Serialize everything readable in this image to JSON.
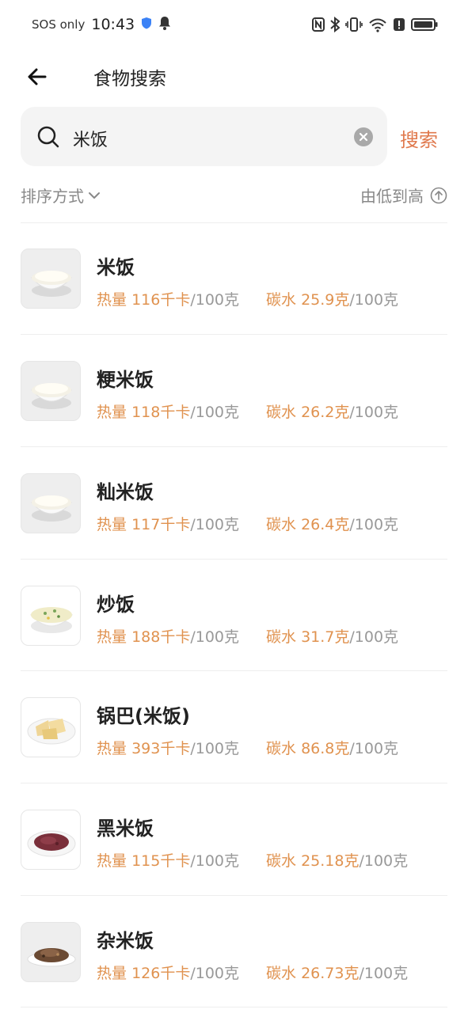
{
  "status_bar": {
    "sos": "SOS only",
    "time": "10:43"
  },
  "header": {
    "title": "食物搜索"
  },
  "search": {
    "query": "米饭",
    "button_label": "搜索"
  },
  "sort": {
    "label": "排序方式",
    "order": "由低到高"
  },
  "foods": [
    {
      "name": "米饭",
      "cal_label": "热量",
      "cal": "116千卡",
      "cal_unit": "/100克",
      "carb_label": "碳水",
      "carb": "25.9克",
      "carb_unit": "/100克",
      "image": "white-rice-bowl"
    },
    {
      "name": "粳米饭",
      "cal_label": "热量",
      "cal": "118千卡",
      "cal_unit": "/100克",
      "carb_label": "碳水",
      "carb": "26.2克",
      "carb_unit": "/100克",
      "image": "white-rice-bowl"
    },
    {
      "name": "籼米饭",
      "cal_label": "热量",
      "cal": "117千卡",
      "cal_unit": "/100克",
      "carb_label": "碳水",
      "carb": "26.4克",
      "carb_unit": "/100克",
      "image": "white-rice-bowl"
    },
    {
      "name": "炒饭",
      "cal_label": "热量",
      "cal": "188千卡",
      "cal_unit": "/100克",
      "carb_label": "碳水",
      "carb": "31.7克",
      "carb_unit": "/100克",
      "image": "fried-rice-bowl"
    },
    {
      "name": "锅巴(米饭)",
      "cal_label": "热量",
      "cal": "393千卡",
      "cal_unit": "/100克",
      "carb_label": "碳水",
      "carb": "86.8克",
      "carb_unit": "/100克",
      "image": "rice-crust-plate"
    },
    {
      "name": "黑米饭",
      "cal_label": "热量",
      "cal": "115千卡",
      "cal_unit": "/100克",
      "carb_label": "碳水",
      "carb": "25.18克",
      "carb_unit": "/100克",
      "image": "black-rice-plate"
    },
    {
      "name": "杂米饭",
      "cal_label": "热量",
      "cal": "126千卡",
      "cal_unit": "/100克",
      "carb_label": "碳水",
      "carb": "26.73克",
      "carb_unit": "/100克",
      "image": "mixed-rice-plate"
    }
  ],
  "colors": {
    "accent": "#e0794d",
    "stat": "#e0924f",
    "muted": "#999999"
  }
}
